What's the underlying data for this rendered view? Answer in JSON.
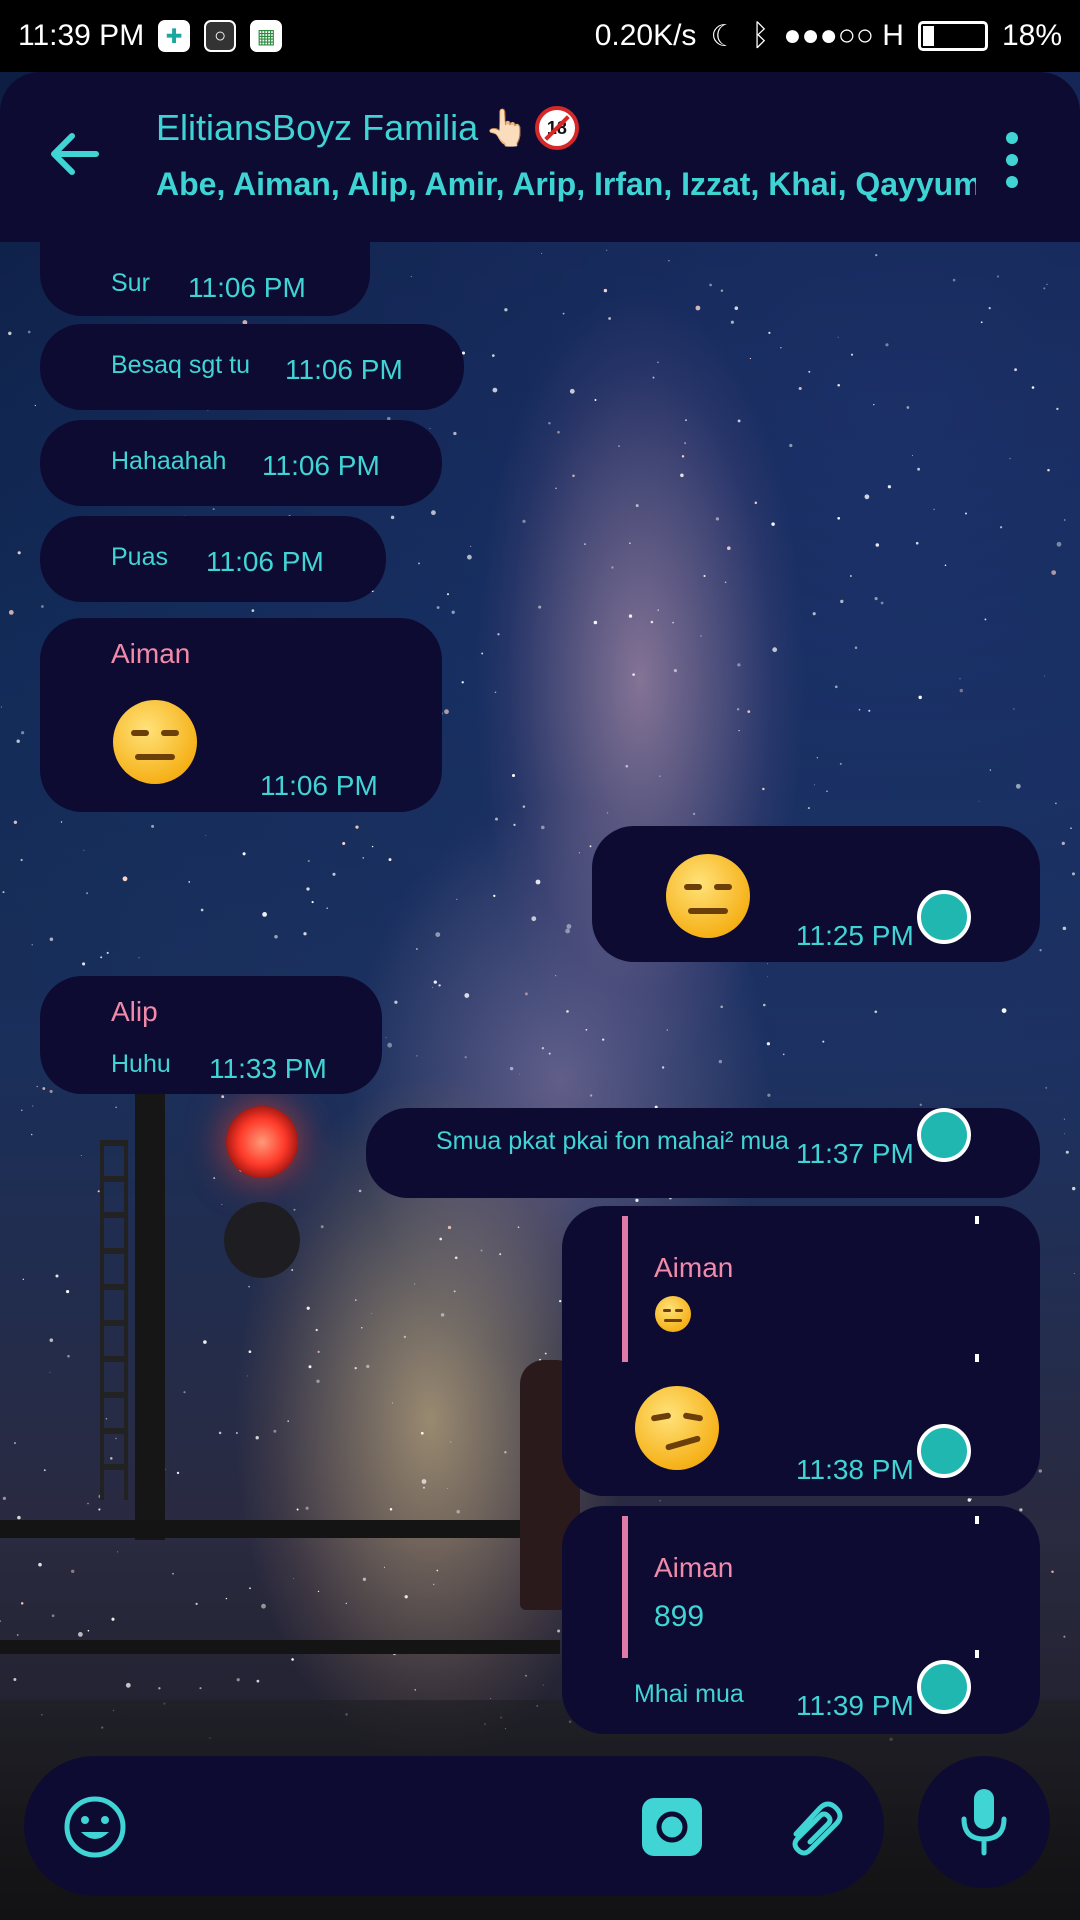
{
  "status_bar": {
    "time": "11:39 PM",
    "network_speed": "0.20K/s",
    "signal": "●●●○○ H",
    "battery": "18%",
    "battery_level": 0.18,
    "icons": [
      "app-notification-icon",
      "app-ring-icon",
      "app-grid-icon",
      "moon-icon",
      "bluetooth-icon",
      "signal-icon",
      "battery-icon"
    ]
  },
  "header": {
    "title": "ElitiansBoyz Familia",
    "title_emoji_1": "👆🏻",
    "title_badge": "18",
    "members": "Abe, Aiman, Alip, Amir, Arip, Irfan, Izzat, Khai, Qayyum, ..."
  },
  "messages": [
    {
      "side": "in",
      "text": "Sur",
      "time": "11:06 PM"
    },
    {
      "side": "in",
      "text": "Besaq sgt tu",
      "time": "11:06 PM"
    },
    {
      "side": "in",
      "text": "Hahaahah",
      "time": "11:06 PM"
    },
    {
      "side": "in",
      "text": "Puas",
      "time": "11:06 PM"
    },
    {
      "side": "in",
      "sender": "Aiman",
      "emoji": "expressionless-face",
      "time": "11:06 PM"
    },
    {
      "side": "out",
      "emoji": "expressionless-face",
      "time": "11:25 PM"
    },
    {
      "side": "in",
      "sender": "Alip",
      "text": "Huhu",
      "time": "11:33 PM"
    },
    {
      "side": "out",
      "text": "Smua pkat pkai fon mahai² mua",
      "time": "11:37 PM"
    },
    {
      "side": "out",
      "quote_sender": "Aiman",
      "quote_emoji": "expressionless-face",
      "emoji": "smirking-face",
      "time": "11:38 PM"
    },
    {
      "side": "out",
      "quote_sender": "Aiman",
      "quote_text": "899",
      "text": "Mhai mua",
      "time": "11:39 PM"
    }
  ],
  "colors": {
    "bubble": "#0e0b33",
    "accent": "#40d4d4",
    "sender": "#f08aa8",
    "status_dot": "#1fb7b0"
  },
  "input_bar": {
    "icons": [
      "emoji-icon",
      "camera-icon",
      "attach-icon",
      "mic-icon"
    ]
  }
}
